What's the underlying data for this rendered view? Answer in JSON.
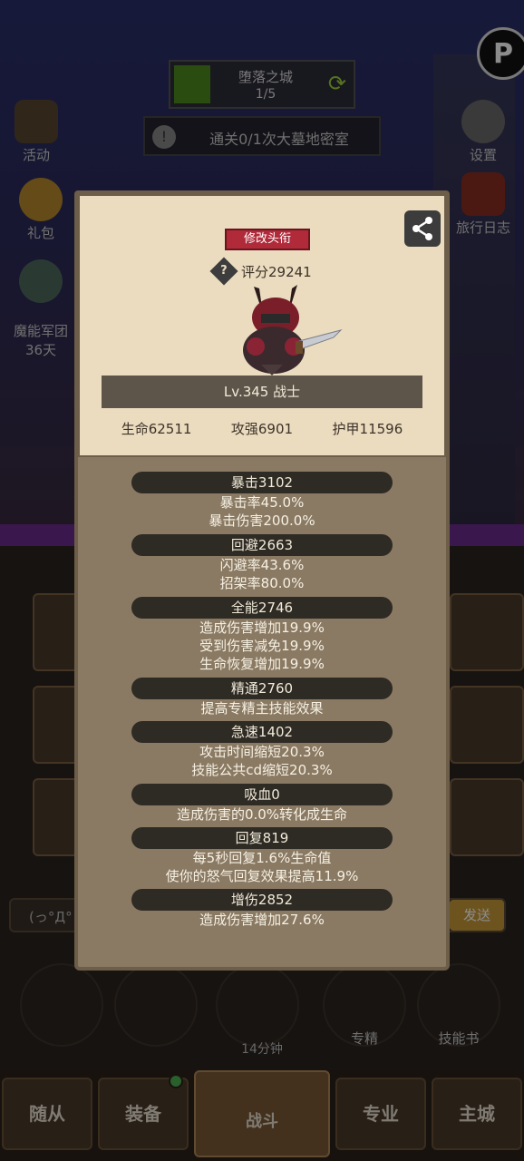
{
  "background": {
    "stage_title": "堕落之城",
    "stage_progress": "1/5",
    "quest_text": "通关0/1次大墓地密室",
    "side_left": [
      {
        "label": "活动",
        "icon": "calendar-icon"
      },
      {
        "label": "礼包",
        "icon": "gift-icon"
      },
      {
        "label": "魔能军团\n36天",
        "icon": "legion-icon"
      }
    ],
    "side_right": [
      {
        "label": "设置",
        "icon": "gear-icon"
      },
      {
        "label": "旅行日志",
        "icon": "book-icon"
      }
    ],
    "chat_text": "(っ°Д°",
    "chat_send": "发送",
    "round_buttons": [
      {
        "label": "",
        "icon": "potion-icon"
      },
      {
        "label": "",
        "icon": "bread-icon"
      },
      {
        "label": "14分钟",
        "icon": "chest-icon"
      },
      {
        "label": "专精",
        "icon": "mastery-icon"
      },
      {
        "label": "技能书",
        "icon": "skillbook-icon"
      }
    ],
    "nav": [
      "随从",
      "装备",
      "战斗",
      "专业",
      "主城"
    ]
  },
  "modal": {
    "title_button": "修改头衔",
    "score": "评分29241",
    "level_class": "Lv.345 战士",
    "hp": "生命62511",
    "attack": "攻强6901",
    "armor": "护甲11596",
    "stats": [
      {
        "header": "暴击3102",
        "lines": [
          "暴击率45.0%",
          "暴击伤害200.0%"
        ]
      },
      {
        "header": "回避2663",
        "lines": [
          "闪避率43.6%",
          "招架率80.0%"
        ]
      },
      {
        "header": "全能2746",
        "lines": [
          "造成伤害增加19.9%",
          "受到伤害减免19.9%",
          "生命恢复增加19.9%"
        ]
      },
      {
        "header": "精通2760",
        "lines": [
          "提高专精主技能效果"
        ]
      },
      {
        "header": "急速1402",
        "lines": [
          "攻击时间缩短20.3%",
          "技能公共cd缩短20.3%"
        ]
      },
      {
        "header": "吸血0",
        "lines": [
          "造成伤害的0.0%转化成生命"
        ]
      },
      {
        "header": "回复819",
        "lines": [
          "每5秒回复1.6%生命值",
          "使你的怒气回复效果提高11.9%"
        ]
      },
      {
        "header": "增伤2852",
        "lines": [
          "造成伤害增加27.6%"
        ]
      }
    ]
  },
  "colors": {
    "parchment": "#ebdcc0",
    "panel": "#8a7a64",
    "pill": "#2e2a24",
    "badge": "#b02a3a"
  }
}
